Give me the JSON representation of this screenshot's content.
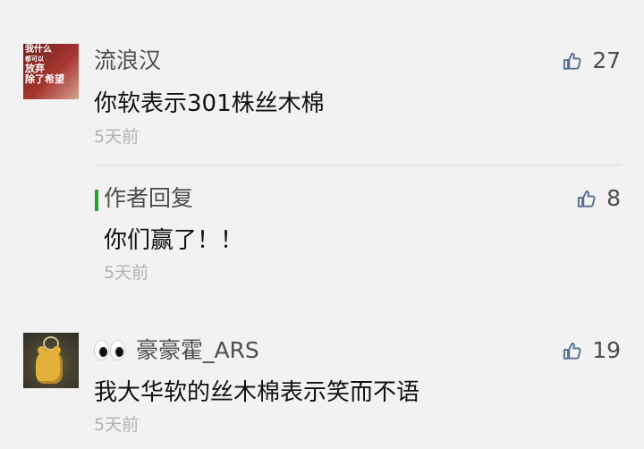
{
  "comments": [
    {
      "author": "流浪汉",
      "avatar_text": [
        "我什么",
        "都可以",
        "放弃",
        "除了希望"
      ],
      "text": "你软表示301株丝木棉",
      "time": "5天前",
      "likes": "27",
      "reply": {
        "label": "作者回复",
        "text": "你们赢了！！",
        "time": "5天前",
        "likes": "8"
      }
    },
    {
      "author": "豪豪霍_ARS",
      "text": "我大华软的丝木棉表示笑而不语",
      "time": "5天前",
      "likes": "19"
    }
  ],
  "colors": {
    "background": "#f2f2f2",
    "author": "#4d4d4d",
    "comment": "#111111",
    "time": "#b2b2b2",
    "like_icon": "#586d93",
    "reply_marker": "#20a52b"
  },
  "icons": {
    "like": "thumbs-up-icon",
    "emoji": "eyes-emoji"
  }
}
